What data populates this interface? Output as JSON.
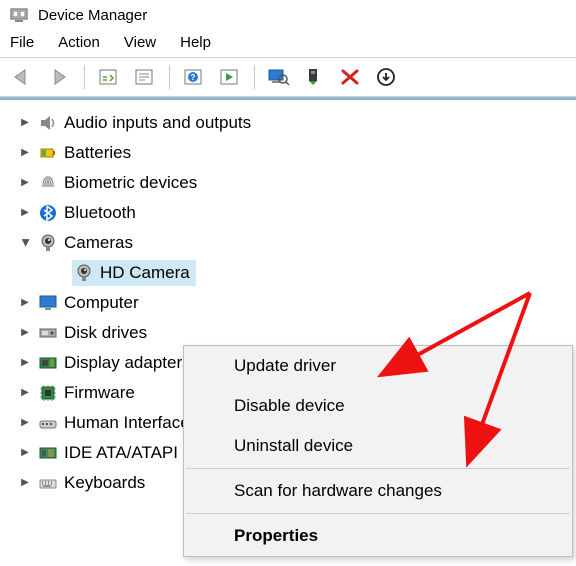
{
  "window": {
    "title": "Device Manager"
  },
  "menubar": {
    "file": "File",
    "action": "Action",
    "view": "View",
    "help": "Help"
  },
  "toolbar_icons": {
    "back": "back-arrow",
    "forward": "forward-arrow",
    "show_hidden": "show-hidden",
    "properties_sheet": "properties-sheet",
    "help_book": "help",
    "action_play": "action",
    "scan": "scan-hardware",
    "update": "update-driver",
    "remove": "uninstall",
    "more": "more"
  },
  "tree": {
    "items": [
      {
        "label": "Audio inputs and outputs",
        "expanded": false,
        "icon": "speaker"
      },
      {
        "label": "Batteries",
        "expanded": false,
        "icon": "battery"
      },
      {
        "label": "Biometric devices",
        "expanded": false,
        "icon": "fingerprint"
      },
      {
        "label": "Bluetooth",
        "expanded": false,
        "icon": "bluetooth"
      },
      {
        "label": "Cameras",
        "expanded": true,
        "icon": "camera",
        "children": [
          {
            "label": "HD Camera",
            "icon": "camera",
            "selected": true
          }
        ]
      },
      {
        "label": "Computer",
        "expanded": false,
        "icon": "monitor"
      },
      {
        "label": "Disk drives",
        "expanded": false,
        "icon": "disk"
      },
      {
        "label": "Display adapters",
        "expanded": false,
        "icon": "display-adapter"
      },
      {
        "label": "Firmware",
        "expanded": false,
        "icon": "chip"
      },
      {
        "label": "Human Interface Devices",
        "expanded": false,
        "icon": "hid"
      },
      {
        "label": "IDE ATA/ATAPI controllers",
        "expanded": false,
        "icon": "ide"
      },
      {
        "label": "Keyboards",
        "expanded": false,
        "icon": "keyboard"
      }
    ]
  },
  "context_menu": {
    "update": "Update driver",
    "disable": "Disable device",
    "uninstall": "Uninstall device",
    "scan": "Scan for hardware changes",
    "properties": "Properties"
  }
}
